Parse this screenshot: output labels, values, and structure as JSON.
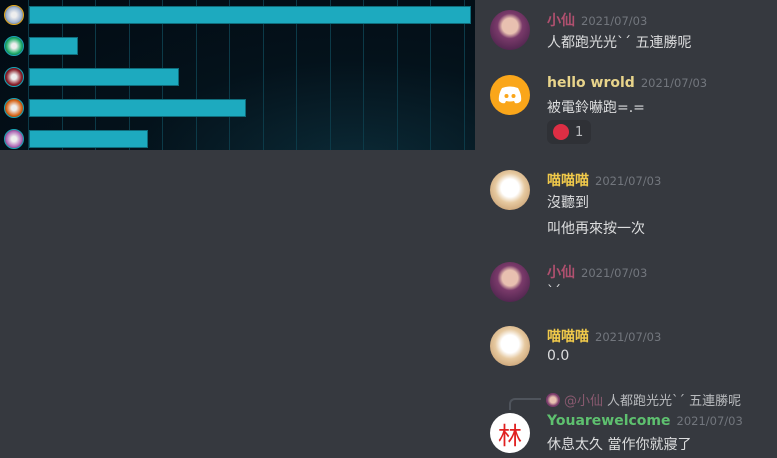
{
  "chart_data": {
    "type": "bar",
    "orientation": "horizontal",
    "categories": [
      "champion-1",
      "champion-2",
      "champion-3",
      "champion-4",
      "champion-5"
    ],
    "values": [
      100,
      11,
      34,
      49,
      27
    ],
    "value_unit": "percent of max",
    "grid": true,
    "colors": {
      "bar": "#1daabf"
    }
  },
  "messages": [
    {
      "author": "小仙",
      "color": "#b0506f",
      "time": "2021/07/03",
      "lines": [
        "人都跑光光ˋˊ 五連勝呢"
      ]
    },
    {
      "author": "hello wrold",
      "color": "#e8d48b",
      "time": "2021/07/03",
      "lines": [
        "被電鈴嚇跑=.="
      ],
      "reaction": {
        "emoji": "angry-face",
        "count": "1"
      }
    },
    {
      "author": "喵喵喵",
      "color": "#f0c94a",
      "time": "2021/07/03",
      "lines": [
        "沒聽到",
        "叫他再來按一次"
      ]
    },
    {
      "author": "小仙",
      "color": "#b0506f",
      "time": "2021/07/03",
      "lines": [
        "ˋˊ"
      ]
    },
    {
      "author": "喵喵喵",
      "color": "#f0c94a",
      "time": "2021/07/03",
      "lines": [
        "0.0"
      ]
    },
    {
      "author": "Youarewelcome",
      "color": "#5ec06f",
      "time": "2021/07/03",
      "lines": [
        "休息太久 當作你就寢了"
      ],
      "reply": {
        "mention": "@小仙",
        "text": "人都跑光光ˋˊ 五連勝呢"
      },
      "avatar_text": "林"
    }
  ]
}
